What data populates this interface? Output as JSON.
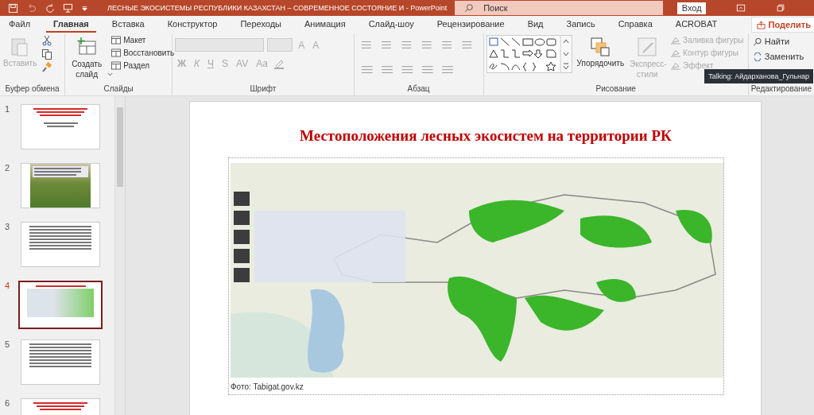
{
  "window": {
    "title": "ЛЕСНЫЕ ЭКОСИСТЕМЫ РЕСПУБЛИКИ КАЗАХСТАН – СОВРЕМЕННОЕ СОСТОЯНИЕ И  -  PowerPoint",
    "search_placeholder": "Поиск",
    "signin": "Вход"
  },
  "tabs": [
    {
      "label": "Файл",
      "selected": false
    },
    {
      "label": "Главная",
      "selected": true
    },
    {
      "label": "Вставка",
      "selected": false
    },
    {
      "label": "Конструктор",
      "selected": false
    },
    {
      "label": "Переходы",
      "selected": false
    },
    {
      "label": "Анимация",
      "selected": false
    },
    {
      "label": "Слайд-шоу",
      "selected": false
    },
    {
      "label": "Рецензирование",
      "selected": false
    },
    {
      "label": "Вид",
      "selected": false
    },
    {
      "label": "Запись",
      "selected": false
    },
    {
      "label": "Справка",
      "selected": false
    },
    {
      "label": "ACROBAT",
      "selected": false
    }
  ],
  "share_button": "Поделить",
  "ribbon": {
    "clipboard": {
      "label": "Буфер обмена",
      "paste": {
        "label": "Вставить",
        "disabled": true
      }
    },
    "slides": {
      "label": "Слайды",
      "new_slide": "Создать слайд",
      "items": [
        "Макет",
        "Восстановить",
        "Раздел"
      ]
    },
    "font": {
      "label": "Шрифт",
      "disabled": true,
      "size_buttons": [
        "A",
        "A"
      ],
      "style_buttons": [
        "Ж",
        "К",
        "Ч",
        "S"
      ],
      "spacing": "AV",
      "case": "Aa"
    },
    "paragraph": {
      "label": "Абзац"
    },
    "drawing": {
      "label": "Рисование",
      "arrange": "Упорядочить",
      "quick_styles": {
        "label": "Экспресс-стили",
        "disabled": true
      },
      "items": [
        {
          "label": "Заливка фигуры",
          "disabled": true
        },
        {
          "label": "Контур фигуры",
          "disabled": true
        },
        {
          "label": "Эффект",
          "disabled": true
        }
      ]
    },
    "editing": {
      "label": "Редактирование",
      "items": [
        "Найти",
        "Заменить"
      ]
    }
  },
  "tooltip": "Talking: Айдарханова_Гульнар",
  "thumbnails": [
    {
      "number": "1",
      "kind": "title",
      "selected": false
    },
    {
      "number": "2",
      "kind": "photo",
      "selected": false
    },
    {
      "number": "3",
      "kind": "text",
      "selected": false
    },
    {
      "number": "4",
      "kind": "map",
      "selected": true
    },
    {
      "number": "5",
      "kind": "text",
      "selected": false
    },
    {
      "number": "6",
      "kind": "title",
      "selected": false
    }
  ],
  "slide": {
    "title": "Местоположения лесных экосистем на территории РК",
    "caption": "Фото: Tabigat.gov.kz"
  }
}
